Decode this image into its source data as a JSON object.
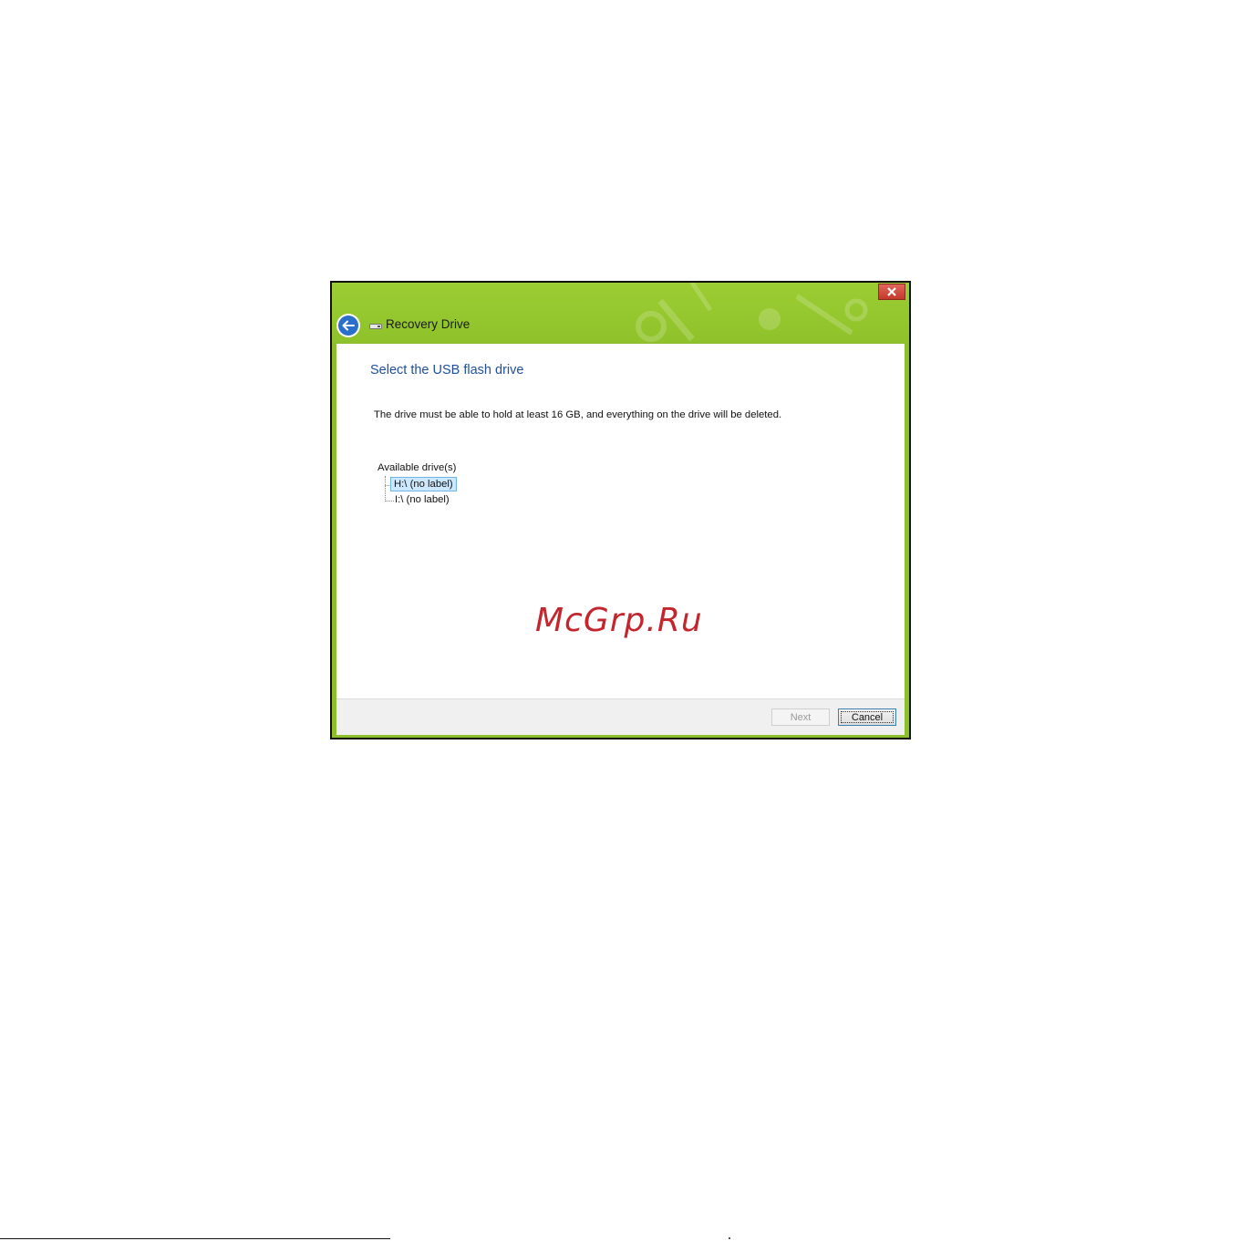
{
  "window": {
    "title": "Recovery Drive",
    "close_symbol": "✕"
  },
  "content": {
    "heading": "Select the USB flash drive",
    "description": "The drive must be able to hold at least 16 GB, and everything on the drive will be deleted.",
    "drives_label": "Available drive(s)",
    "drives": [
      {
        "label": "H:\\ (no label)",
        "selected": true
      },
      {
        "label": "I:\\ (no label)",
        "selected": false
      }
    ]
  },
  "watermark": "McGrp.Ru",
  "footer": {
    "next_label": "Next",
    "next_enabled": false,
    "cancel_label": "Cancel"
  },
  "colors": {
    "titlebar": "#8dbe2b",
    "heading": "#1f4f9c",
    "close_button": "#c4392b",
    "back_button": "#2a6fc9",
    "selection": "#cce8ff",
    "watermark": "#c4262e"
  },
  "icons": [
    "back-arrow-icon",
    "drive-icon",
    "close-icon"
  ]
}
